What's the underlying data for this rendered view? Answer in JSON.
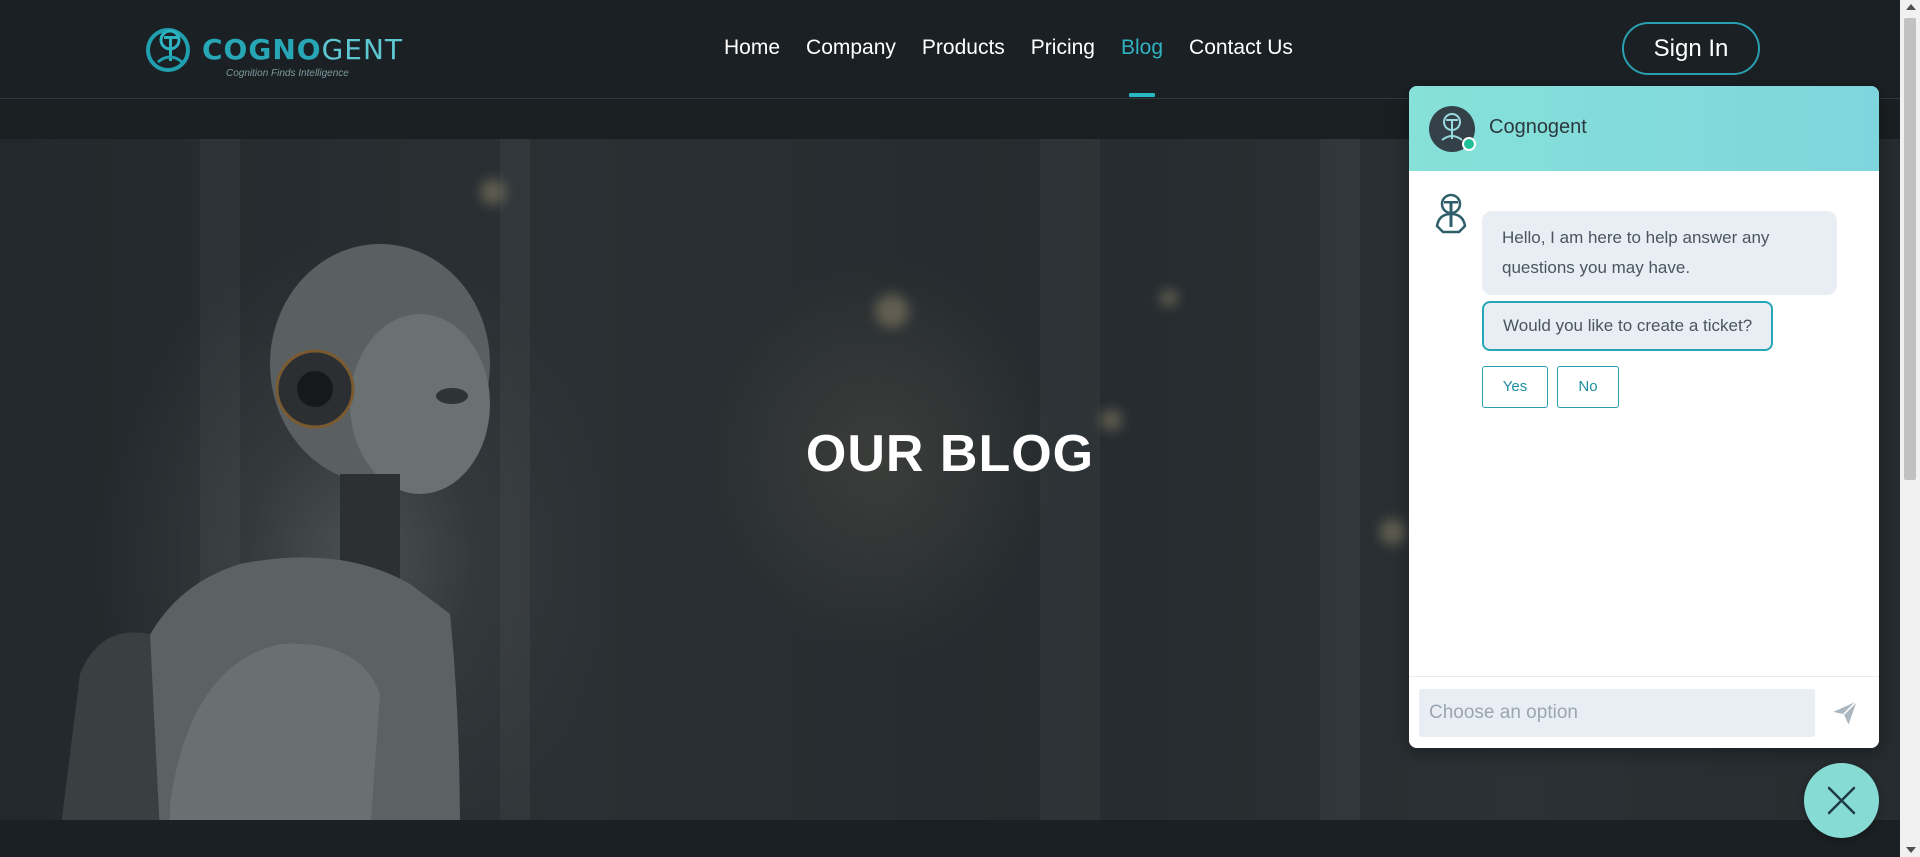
{
  "brand": {
    "name_bold": "COGNO",
    "name_thin": "GENT",
    "tagline": "Cognition Finds Intelligence",
    "logo_icon": "cognogent-logo-icon"
  },
  "nav": {
    "items": [
      {
        "label": "Home"
      },
      {
        "label": "Company"
      },
      {
        "label": "Products"
      },
      {
        "label": "Pricing"
      },
      {
        "label": "Blog",
        "active": true
      },
      {
        "label": "Contact Us"
      }
    ],
    "signin_label": "Sign In"
  },
  "hero": {
    "title": "OUR BLOG"
  },
  "chat": {
    "agent_name": "Cognogent",
    "status": "online",
    "messages": [
      {
        "from": "bot",
        "text": "Hello, I am here to help answer any questions you may have."
      },
      {
        "from": "bot",
        "text": "Would you like to create a ticket?"
      }
    ],
    "options": [
      {
        "label": "Yes"
      },
      {
        "label": "No"
      }
    ],
    "input_placeholder": "Choose an option",
    "send_icon": "send-icon",
    "close_icon": "close-icon"
  },
  "colors": {
    "accent": "#2fb3c2",
    "header_bg": "#1b2024",
    "chat_header": "#86e1d9",
    "bubble_bg": "#e9eef4",
    "online": "#1fbf9a"
  }
}
